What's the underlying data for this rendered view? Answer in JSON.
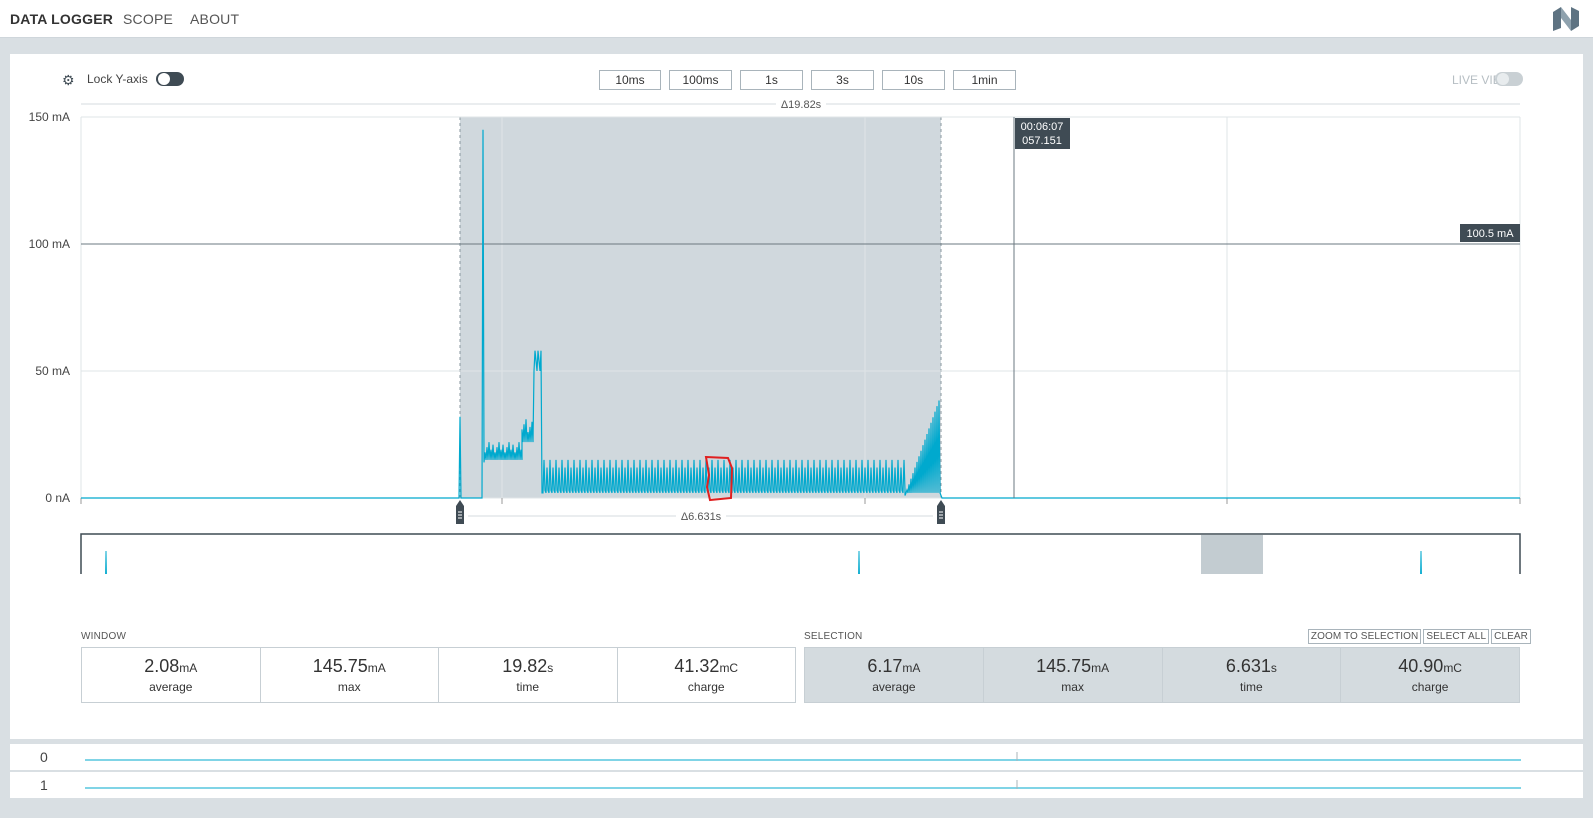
{
  "nav": {
    "items": [
      "DATA LOGGER",
      "SCOPE",
      "ABOUT"
    ]
  },
  "controls": {
    "lock_label": "Lock Y-axis",
    "time_buttons": [
      "10ms",
      "100ms",
      "1s",
      "3s",
      "10s",
      "1min"
    ],
    "live_view": "LIVE VIEW"
  },
  "chart": {
    "window_delta": "Δ19.82s",
    "selection_delta": "Δ6.631s",
    "y_ticks": [
      "150 mA",
      "100 mA",
      "50 mA",
      "0 nA"
    ],
    "cursor_time": "00:06:07",
    "cursor_ms": "057.151",
    "y_cursor_label": "100.5 mA"
  },
  "chart_data": {
    "type": "line",
    "ylabel": "",
    "ylim": [
      0,
      150
    ],
    "unit": "mA",
    "annotations": [
      "100.5 mA",
      "00:06:07 057.151",
      "Δ19.82s",
      "Δ6.631s"
    ]
  },
  "window": {
    "label": "WINDOW",
    "stats": [
      {
        "value": "2.08",
        "unit": "mA",
        "label": "average"
      },
      {
        "value": "145.75",
        "unit": "mA",
        "label": "max"
      },
      {
        "value": "19.82",
        "unit": "s",
        "label": "time"
      },
      {
        "value": "41.32",
        "unit": "mC",
        "label": "charge"
      }
    ]
  },
  "selection": {
    "label": "SELECTION",
    "buttons": [
      "ZOOM TO SELECTION",
      "SELECT ALL",
      "CLEAR"
    ],
    "stats": [
      {
        "value": "6.17",
        "unit": "mA",
        "label": "average"
      },
      {
        "value": "145.75",
        "unit": "mA",
        "label": "max"
      },
      {
        "value": "6.631",
        "unit": "s",
        "label": "time"
      },
      {
        "value": "40.90",
        "unit": "mC",
        "label": "charge"
      }
    ]
  },
  "digital_channels": [
    "0",
    "1"
  ],
  "colors": {
    "trace": "#00a9ce",
    "selection": "#d0d8dd",
    "dark": "#3f4b54"
  }
}
